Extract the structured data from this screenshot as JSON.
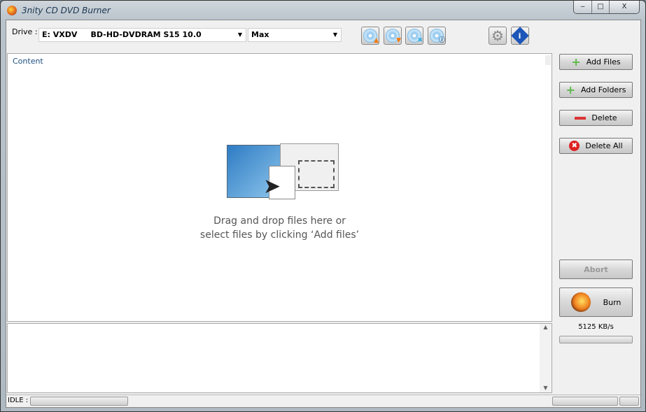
{
  "window": {
    "title": "3nity CD DVD Burner",
    "minimize": "‒",
    "maximize": "□",
    "close": "X"
  },
  "toolbar": {
    "drive_label": "Drive :",
    "drive_value": "E: VXDV     BD-HD-DVDRAM S15 10.0",
    "speed_value": "Max",
    "icons": [
      "burn-image-icon",
      "copy-disc-icon",
      "erase-disc-icon",
      "disc-info-icon",
      "settings-icon",
      "about-icon"
    ]
  },
  "content": {
    "header": "Content",
    "hint_line1": "Drag and drop files here or",
    "hint_line2": "select files by clicking ‘Add files’"
  },
  "actions": {
    "add_files": "Add Files",
    "add_folders": "Add Folders",
    "delete": "Delete",
    "delete_all": "Delete All",
    "abort": "Abort",
    "burn": "Burn"
  },
  "status": {
    "speed": "5125 KB/s",
    "state": "IDLE :",
    "burn_progress": 0,
    "idle_progress": 0
  }
}
